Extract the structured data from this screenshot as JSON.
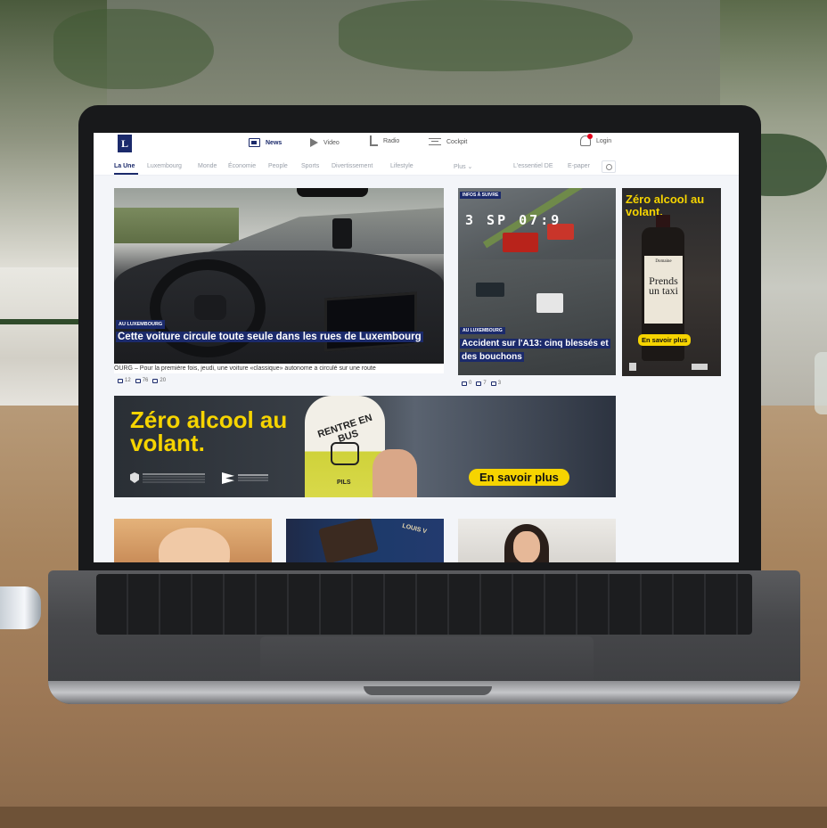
{
  "header": {
    "logo": "L",
    "nav": [
      {
        "label": "News",
        "icon": "newspaper-icon",
        "active": true
      },
      {
        "label": "Video",
        "icon": "play-icon",
        "active": false
      },
      {
        "label": "Radio",
        "icon": "radio-icon",
        "active": false
      },
      {
        "label": "Cockpit",
        "icon": "sliders-icon",
        "active": false
      }
    ],
    "login_label": "Login"
  },
  "subnav": {
    "items": [
      {
        "label": "La Une",
        "active": true
      },
      {
        "label": "Luxembourg"
      },
      {
        "label": "Monde"
      },
      {
        "label": "Économie"
      },
      {
        "label": "People"
      },
      {
        "label": "Sports"
      },
      {
        "label": "Divertissement"
      },
      {
        "label": "Lifestyle"
      }
    ],
    "more_label": "Plus ⌄",
    "essentiel_label": "L'essentiel DE",
    "epaper_label": "E-paper"
  },
  "main_article": {
    "tag": "AU LUXEMBOURG",
    "title": "Cette voiture circule toute seule dans les rues de Luxembourg",
    "lead": "OURG – Pour la première fois, jeudi, une voiture «classique» autonome a circulé sur une route",
    "stats": {
      "comments": "12",
      "likes": "76",
      "shares": "20"
    }
  },
  "second_article": {
    "top_tag": "INFOS À SUIVRE",
    "cam_time": "3 SP 07:9",
    "tag": "AU LUXEMBOURG",
    "title": "Accident sur l'A13: cinq blessés et des bouchons",
    "stats": {
      "comments": "0",
      "likes": "7",
      "shares": "3"
    }
  },
  "side_ad": {
    "headline": "Zéro alcool au volant.",
    "label_small": "Domaine",
    "label_big": "Prends un taxi",
    "button": "En savoir plus"
  },
  "banner_ad": {
    "headline": "Zéro alcool au volant.",
    "beer_text": "RENTRE EN BUS",
    "beer_sub": "PILS",
    "button": "En savoir plus"
  },
  "thumbnails": {
    "third_label": "LOUIS V"
  },
  "colors": {
    "brand": "#1b2a6b",
    "accent_yellow": "#f6d400",
    "notification": "#e3001b"
  }
}
